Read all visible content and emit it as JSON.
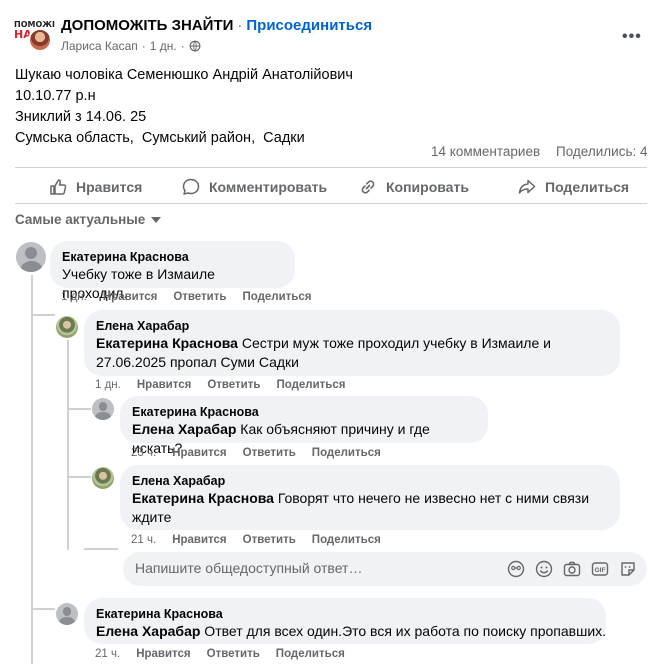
{
  "header": {
    "logo_line1": "ПОМОЖІ",
    "logo_line2": "НА",
    "group_name": "ДОПОМОЖІТЬ ЗНАЙТИ",
    "separator": "·",
    "join_label": "Присоединиться",
    "author": "Лариса Касап",
    "time": "1 дн.",
    "more_label": "•••"
  },
  "post": {
    "lines": [
      "Шукаю чоловіка Семенюшко Андрій Анатолійович",
      "10.10.77 р.н",
      "Зниклий з 14.06. 25",
      "Сумська область,  Сумський район,  Садки"
    ],
    "comments_count": "14 комментариев",
    "shares_count": "Поделились: 4"
  },
  "actions": {
    "like": "Нравится",
    "comment": "Комментировать",
    "copy": "Копировать",
    "share": "Поделиться"
  },
  "sort_label": "Самые актуальные",
  "comments": [
    {
      "name": "Екатерина Краснова",
      "mention": "",
      "text": "Учебку тоже в Измаиле проходил.",
      "time": "1 дн.",
      "like": "Нравится",
      "reply": "Ответить",
      "share": "Поделиться"
    },
    {
      "name": "Елена Харабар",
      "mention": "Екатерина Краснова",
      "text_line1": " Сестри муж тоже проходил учебку в Измаиле и",
      "text_line2": "27.06.2025 пропал Суми Садки",
      "time": "1 дн.",
      "like": "Нравится",
      "reply": "Ответить",
      "share": "Поделиться"
    },
    {
      "name": "Екатерина Краснова",
      "mention": "Елена Харабар",
      "text": " Как объясняют причину и где искать?",
      "time": "23 ч.",
      "like": "Нравится",
      "reply": "Ответить",
      "share": "Поделиться"
    },
    {
      "name": "Елена Харабар",
      "mention": "Екатерина Краснова",
      "text_line1": " Говорят что нечего не извесно нет с ними связи",
      "text_line2": "ждите",
      "time": "21 ч.",
      "like": "Нравится",
      "reply": "Ответить",
      "share": "Поделиться"
    },
    {
      "name": "Екатерина Краснова",
      "mention": "Елена Харабар",
      "text": " Ответ для всех один.Это вся их работа по поиску пропавших.",
      "time": "21 ч.",
      "like": "Нравится",
      "reply": "Ответить",
      "share": "Поделиться"
    }
  ],
  "reply_input": {
    "placeholder": "Напишите общедоступный ответ…",
    "icons": [
      "sticker-face-icon",
      "emoji-icon",
      "camera-icon",
      "gif-icon",
      "sticker-icon"
    ]
  },
  "colors": {
    "link_blue": "#0064d1",
    "secondary_text": "#65676b",
    "bubble_bg": "#f0f2f5",
    "logo_red": "#d9232d"
  }
}
